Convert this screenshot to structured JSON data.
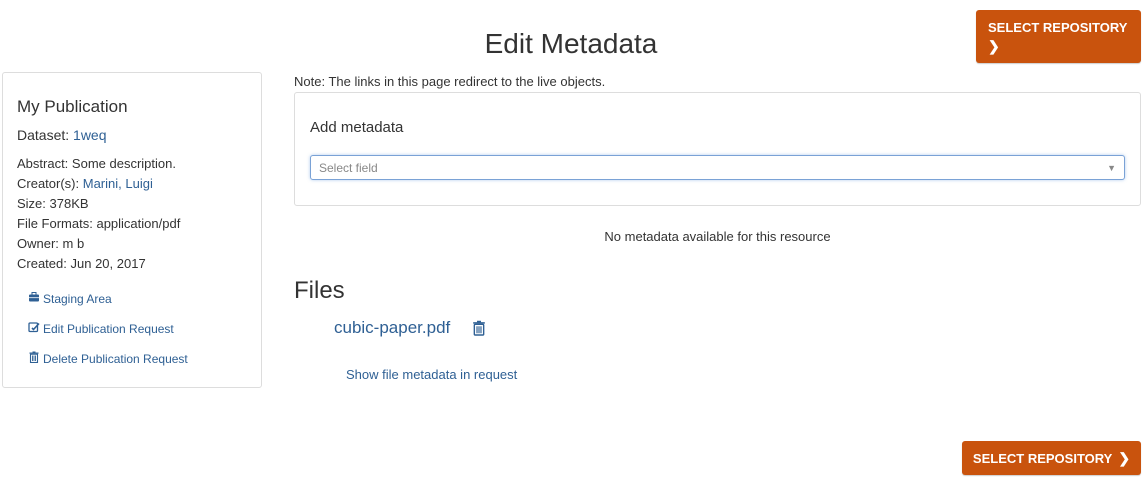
{
  "header": {
    "title": "Edit Metadata",
    "select_repository_label": "SELECT REPOSITORY"
  },
  "publication": {
    "title": "My Publication",
    "dataset_label": "Dataset:",
    "dataset_name": "1weq",
    "abstract_label": "Abstract:",
    "abstract_value": "Some description.",
    "creators_label": "Creator(s):",
    "creators_value": "Marini, Luigi",
    "size_label": "Size:",
    "size_value": "378KB",
    "formats_label": "File Formats:",
    "formats_value": "application/pdf",
    "owner_label": "Owner:",
    "owner_value": "m b",
    "created_label": "Created:",
    "created_value": "Jun 20, 2017"
  },
  "sidebar_links": [
    {
      "label": "Staging Area",
      "icon": "briefcase-icon"
    },
    {
      "label": "Edit Publication Request",
      "icon": "edit-icon"
    },
    {
      "label": "Delete Publication Request",
      "icon": "trash-icon"
    }
  ],
  "main": {
    "note": "Note: The links in this page redirect to the live objects.",
    "add_metadata_title": "Add metadata",
    "select_placeholder": "Select field",
    "no_metadata_text": "No metadata available for this resource",
    "files_title": "Files",
    "file_name": "cubic-paper.pdf",
    "show_file_metadata": "Show file metadata in request"
  },
  "colors": {
    "accent_orange": "#c9530d",
    "link_blue": "#2f6094"
  }
}
